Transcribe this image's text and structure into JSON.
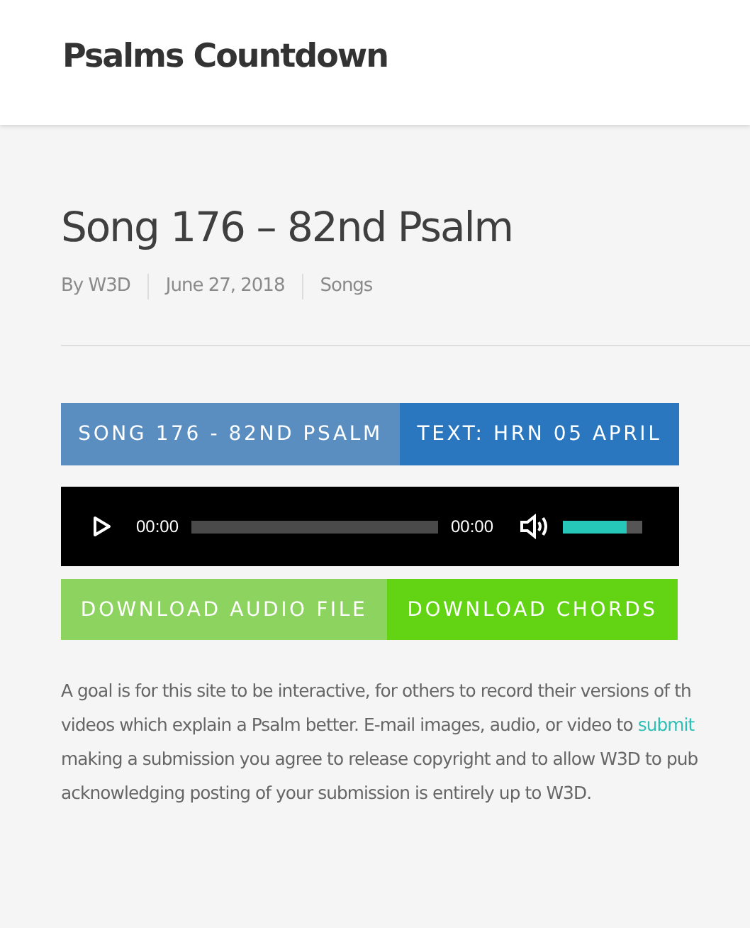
{
  "site": {
    "title": "Psalms Countdown"
  },
  "post": {
    "title": "Song 176 – 82nd Psalm",
    "meta": [
      "By W3D",
      "June 27, 2018",
      "Songs"
    ],
    "links": [
      {
        "label": "SONG 176 - 82ND PSALM",
        "color": "#5b8ec0"
      },
      {
        "label": "TEXT: HRN 05 APRIL",
        "color": "#2a77c0"
      }
    ],
    "player": {
      "current_time": "00:00",
      "duration": "00:00",
      "volume": {
        "level": 0.8
      }
    },
    "downloads": [
      {
        "label": "DOWNLOAD AUDIO FILE",
        "color": "#8dd35f"
      },
      {
        "label": "DOWNLOAD CHORDS",
        "color": "#63d414"
      }
    ],
    "paragraph_lines": [
      {
        "text": "A goal is for this site to be interactive, for others to record their versions of th"
      },
      {
        "text": "videos which explain a Psalm better. E-mail images, audio, or video to ",
        "link": "submit"
      },
      {
        "text": "making a submission you agree to release copyright and to allow W3D to pub"
      },
      {
        "text": "acknowledging posting of your submission is entirely up to W3D."
      }
    ]
  }
}
